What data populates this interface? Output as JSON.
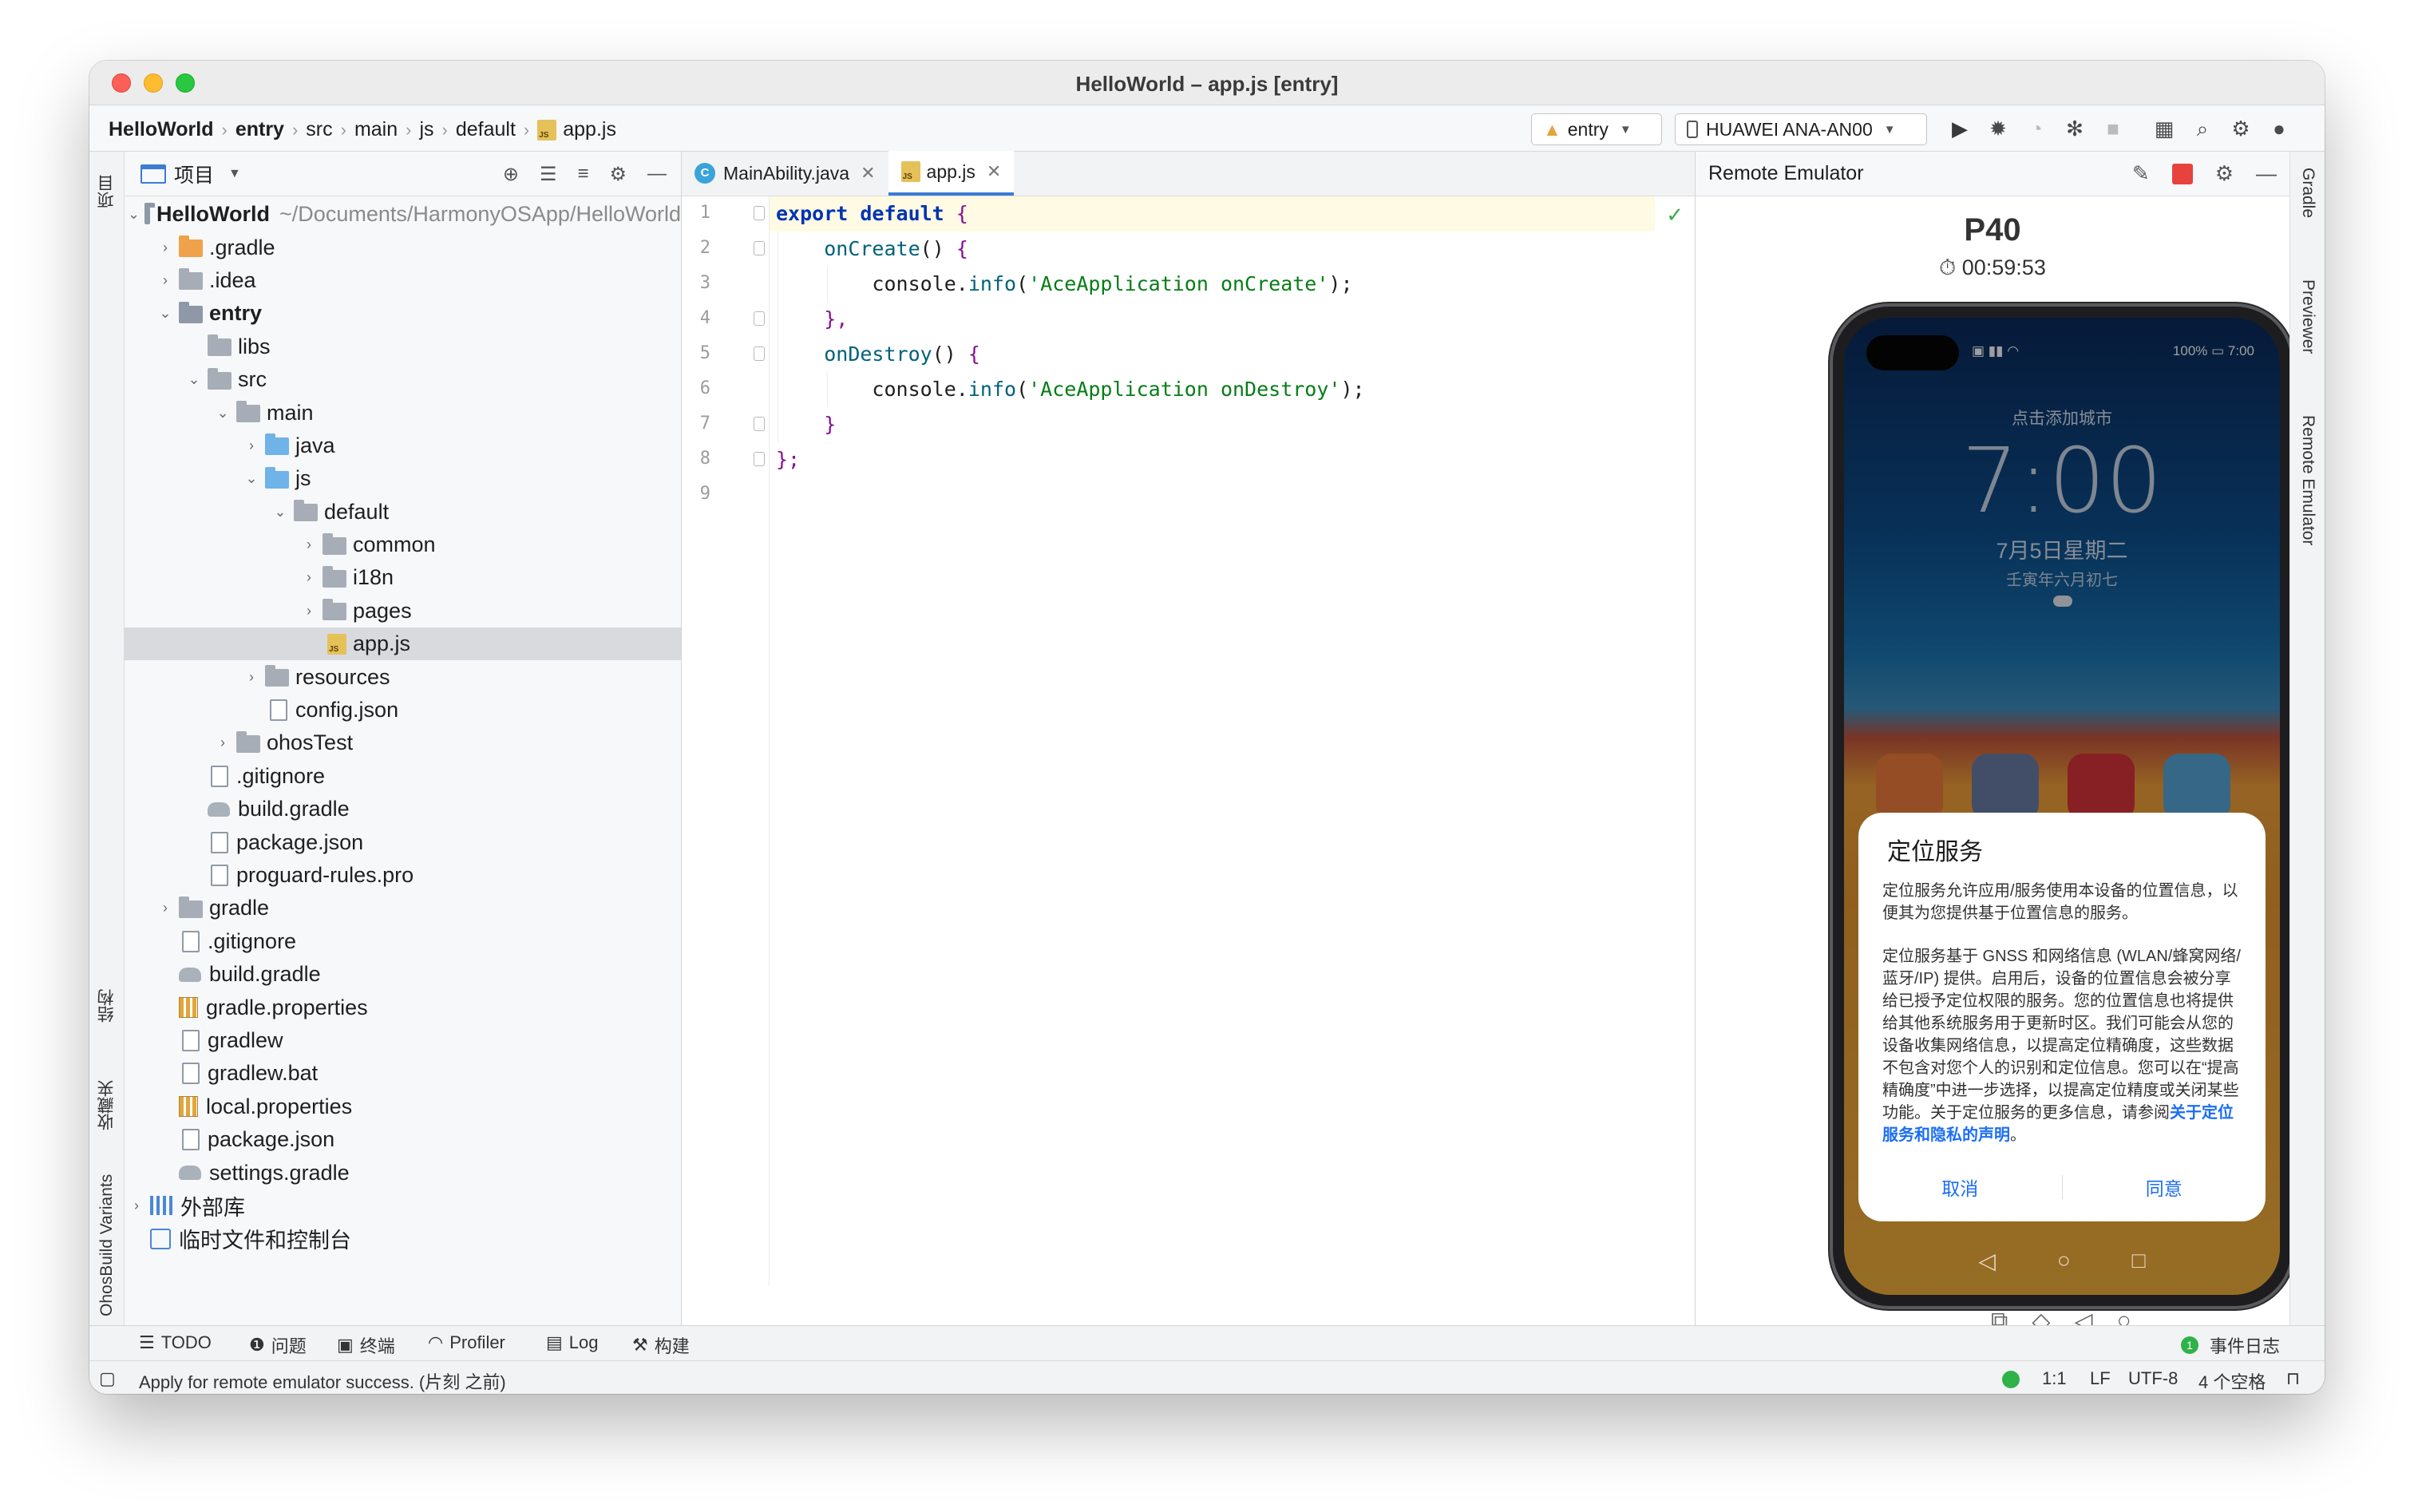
{
  "window": {
    "title": "HelloWorld – app.js [entry]"
  },
  "breadcrumb": [
    "HelloWorld",
    "entry",
    "src",
    "main",
    "js",
    "default",
    "app.js"
  ],
  "run_config": {
    "module": "entry",
    "device": "HUAWEI ANA-AN00"
  },
  "left_stripe": {
    "project": "项目",
    "structure": "结构",
    "favorites": "收藏夹",
    "build_variants": "OhosBuild Variants"
  },
  "project_panel": {
    "title": "项目",
    "tree": [
      {
        "label": "HelloWorld",
        "path": "~/Documents/HarmonyOSApp/HelloWorld"
      },
      {
        "label": ".gradle"
      },
      {
        "label": ".idea"
      },
      {
        "label": "entry"
      },
      {
        "label": "libs"
      },
      {
        "label": "src"
      },
      {
        "label": "main"
      },
      {
        "label": "java"
      },
      {
        "label": "js"
      },
      {
        "label": "default"
      },
      {
        "label": "common"
      },
      {
        "label": "i18n"
      },
      {
        "label": "pages"
      },
      {
        "label": "app.js"
      },
      {
        "label": "resources"
      },
      {
        "label": "config.json"
      },
      {
        "label": "ohosTest"
      },
      {
        "label": ".gitignore"
      },
      {
        "label": "build.gradle"
      },
      {
        "label": "package.json"
      },
      {
        "label": "proguard-rules.pro"
      },
      {
        "label": "gradle"
      },
      {
        "label": ".gitignore"
      },
      {
        "label": "build.gradle"
      },
      {
        "label": "gradle.properties"
      },
      {
        "label": "gradlew"
      },
      {
        "label": "gradlew.bat"
      },
      {
        "label": "local.properties"
      },
      {
        "label": "package.json"
      },
      {
        "label": "settings.gradle"
      },
      {
        "label": "外部库"
      },
      {
        "label": "临时文件和控制台"
      }
    ]
  },
  "editor": {
    "tabs": [
      {
        "label": "MainAbility.java"
      },
      {
        "label": "app.js"
      }
    ],
    "line_numbers": [
      "1",
      "2",
      "3",
      "4",
      "5",
      "6",
      "7",
      "8",
      "9"
    ],
    "code": {
      "export": "export",
      "default": "default",
      "open": "{",
      "onCreate": "onCreate",
      "parens": "()",
      "console1": "console",
      "info1": "info",
      "str1": "'AceApplication onCreate'",
      "close_comma": "},",
      "onDestroy": "onDestroy",
      "str2": "'AceApplication onDestroy'",
      "close": "}",
      "close_semi": "};"
    }
  },
  "emulator": {
    "panel_title": "Remote Emulator",
    "device_name": "P40",
    "timer": "00:59:53",
    "phone": {
      "status_time": "7:00",
      "battery": "100%",
      "city": "点击添加城市",
      "time": "7:00",
      "date": "7月5日星期二",
      "lunar": "壬寅年六月初七"
    },
    "dialog": {
      "title": "定位服务",
      "para1": "定位服务允许应用/服务使用本设备的位置信息，以便其为您提供基于位置信息的服务。",
      "para2": "定位服务基于 GNSS 和网络信息 (WLAN/蜂窝网络/蓝牙/IP) 提供。启用后，设备的位置信息会被分享给已授予定位权限的服务。您的位置信息也将提供给其他系统服务用于更新时区。我们可能会从您的设备收集网络信息，以提高定位精确度，这些数据不包含对您个人的识别和定位信息。您可以在“提高精确度”中进一步选择，以提高定位精度或关闭某些功能。关于定位服务的更多信息，请参阅",
      "link": "关于定位服务和隐私的声明",
      "period": "。",
      "cancel": "取消",
      "agree": "同意"
    }
  },
  "right_stripe": {
    "gradle": "Gradle",
    "previewer": "Previewer",
    "remote_emulator": "Remote Emulator"
  },
  "bottom_tools": {
    "todo": "TODO",
    "problems": "问题",
    "terminal": "终端",
    "profiler": "Profiler",
    "log": "Log",
    "build": "构建",
    "event_log": "事件日志",
    "event_count": "1"
  },
  "status_bar": {
    "message": "Apply for remote emulator success. (片刻 之前)",
    "position": "1:1",
    "line_sep": "LF",
    "encoding": "UTF-8",
    "indent": "4 个空格"
  },
  "colors": {
    "accent": "#3b7bd4",
    "dialog_link": "#1a6ef5",
    "stop": "#e8423f",
    "ok": "#2fb24a"
  }
}
